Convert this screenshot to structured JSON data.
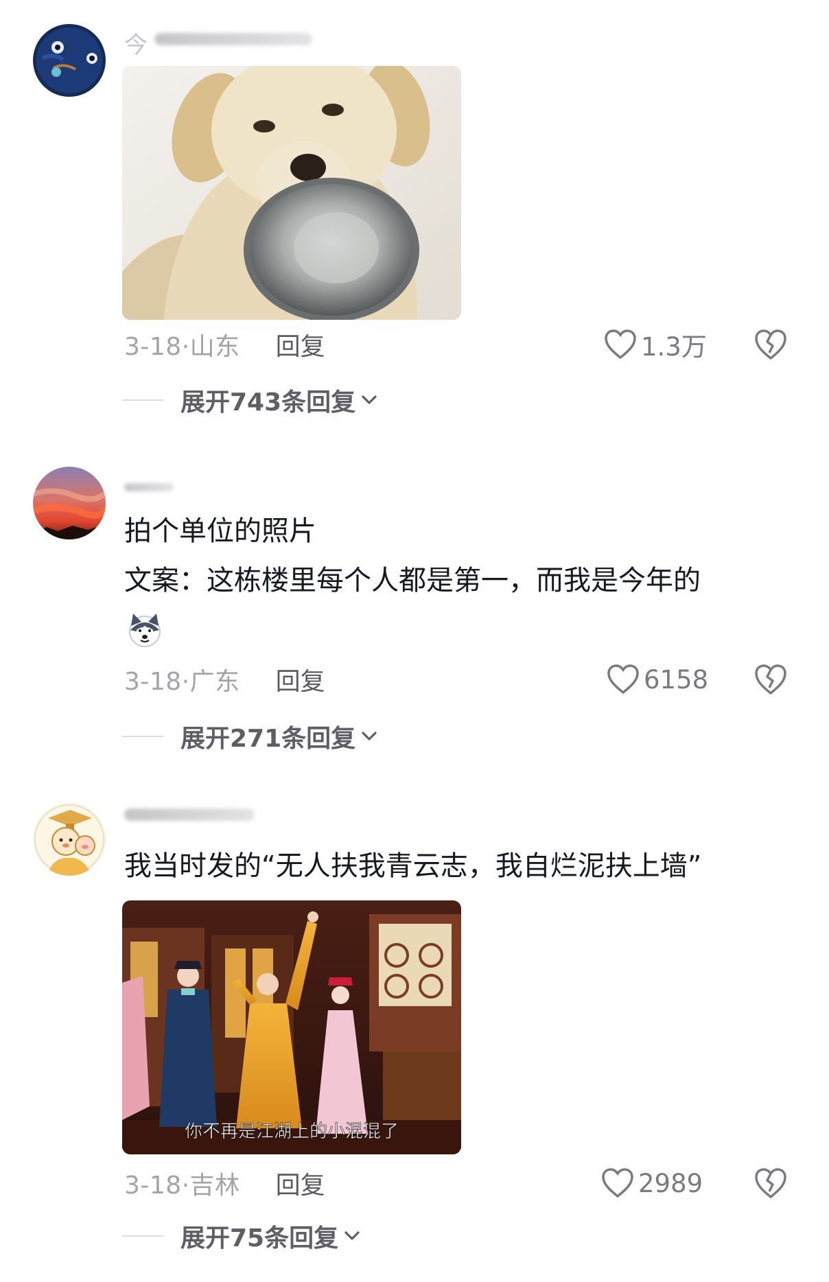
{
  "comments": [
    {
      "text": [],
      "subtitle": "",
      "date": "3-18·",
      "location": "山东",
      "reply_label": "回复",
      "likes": "1.3万",
      "expand_label": "展开743条回复"
    },
    {
      "text": [
        "拍个单位的照片",
        "文案：这栋楼里每个人都是第一，而我是今年的"
      ],
      "date": "3-18·",
      "location": "广东",
      "reply_label": "回复",
      "likes": "6158",
      "expand_label": "展开271条回复"
    },
    {
      "text": [
        "我当时发的“无人扶我青云志，我自烂泥扶上墙”"
      ],
      "subtitle": "你不再是江湖上的小混混了",
      "date": "3-18·",
      "location": "吉林",
      "reply_label": "回复",
      "likes": "2989",
      "expand_label": "展开75条回复"
    }
  ],
  "icons": {
    "like": "heart-outline-icon",
    "dislike": "broken-heart-icon",
    "expand": "chevron-down-icon"
  },
  "colors": {
    "text_primary": "#161823",
    "text_secondary": "#a3a3a8",
    "reply": "#5a5a62"
  }
}
